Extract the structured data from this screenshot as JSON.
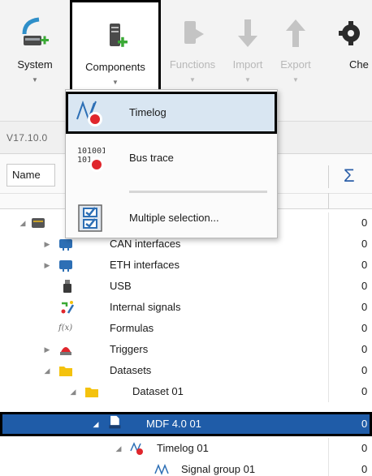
{
  "ribbon": {
    "buttons": [
      {
        "label": "System",
        "icon": "system-add-icon",
        "disabled": false
      },
      {
        "label": "Components",
        "icon": "components-add-icon",
        "disabled": false,
        "active": true
      },
      {
        "label": "Functions",
        "icon": "functions-icon",
        "disabled": true
      },
      {
        "label": "Import",
        "icon": "import-arrow-icon",
        "disabled": true
      },
      {
        "label": "Export",
        "icon": "export-arrow-icon",
        "disabled": true
      },
      {
        "label": "Che",
        "icon": "gear-icon",
        "disabled": false
      }
    ]
  },
  "version": "V17.10.0",
  "grid": {
    "name_header": "Name",
    "sum_header": "Σ"
  },
  "menu": {
    "items": [
      {
        "label": "Timelog",
        "icon": "timelog-icon",
        "highlighted": true
      },
      {
        "label": "Bus trace",
        "icon": "bus-trace-icon",
        "highlighted": false
      },
      {
        "label": "Multiple selection...",
        "icon": "multiple-selection-icon",
        "highlighted": false
      }
    ]
  },
  "tree": {
    "rows": [
      {
        "label": "",
        "value": "0",
        "icon": "device-icon"
      },
      {
        "label": "CAN interfaces",
        "value": "0",
        "icon": "can-icon"
      },
      {
        "label": "ETH interfaces",
        "value": "0",
        "icon": "eth-icon"
      },
      {
        "label": "USB",
        "value": "0",
        "icon": "usb-icon"
      },
      {
        "label": "Internal signals",
        "value": "0",
        "icon": "internal-signals-icon"
      },
      {
        "label": "Formulas",
        "value": "0",
        "icon": "formula-icon"
      },
      {
        "label": "Triggers",
        "value": "0",
        "icon": "trigger-icon"
      },
      {
        "label": "Datasets",
        "value": "0",
        "icon": "folder-icon"
      },
      {
        "label": "Dataset 01",
        "value": "0",
        "icon": "folder-icon"
      },
      {
        "label": "MDF 4.0 01",
        "value": "0",
        "icon": "mdf-file-icon"
      },
      {
        "label": "Timelog 01",
        "value": "0",
        "icon": "timelog-icon"
      },
      {
        "label": "Signal group 01",
        "value": "0",
        "icon": "signal-group-icon"
      }
    ]
  },
  "colors": {
    "selection": "#1f5ca8",
    "accent_green": "#3aa935",
    "accent_red": "#e0262c",
    "folder": "#f4c20d"
  }
}
